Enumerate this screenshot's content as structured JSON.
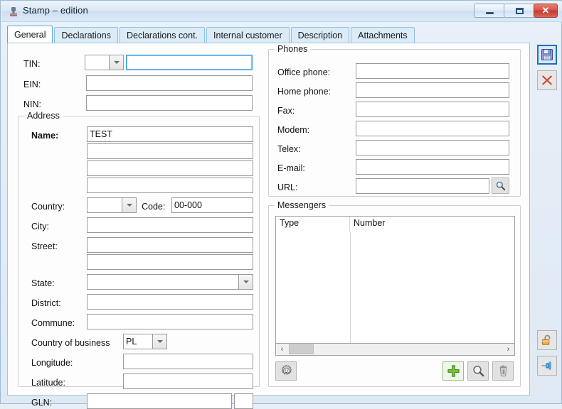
{
  "window": {
    "title": "Stamp – edition",
    "app_icon": "stamp-icon",
    "controls": {
      "minimize": "Minimize",
      "maximize": "Maximize",
      "close": "Close"
    }
  },
  "tabs": [
    {
      "label": "General",
      "active": true
    },
    {
      "label": "Declarations",
      "active": false
    },
    {
      "label": "Declarations cont.",
      "active": false
    },
    {
      "label": "Internal customer",
      "active": false
    },
    {
      "label": "Description",
      "active": false
    },
    {
      "label": "Attachments",
      "active": false
    }
  ],
  "identifiers": {
    "tin": {
      "label": "TIN:",
      "prefix_value": "",
      "value": ""
    },
    "ein": {
      "label": "EIN:",
      "value": ""
    },
    "nin": {
      "label": "NIN:",
      "value": ""
    }
  },
  "address": {
    "legend": "Address",
    "name": {
      "label": "Name:",
      "value": "TEST"
    },
    "name_line2": "",
    "name_line3": "",
    "name_line4": "",
    "country": {
      "label": "Country:",
      "value": ""
    },
    "code": {
      "label": "Code:",
      "value": "00-000"
    },
    "city": {
      "label": "City:",
      "value": ""
    },
    "street": {
      "label": "Street:",
      "value": ""
    },
    "street_line2": "",
    "state": {
      "label": "State:",
      "value": ""
    },
    "district": {
      "label": "District:",
      "value": ""
    },
    "commune": {
      "label": "Commune:",
      "value": ""
    },
    "country_of_business": {
      "label": "Country of business",
      "suffix": ":",
      "value": "PL"
    },
    "longitude": {
      "label": "Longitude:",
      "value": ""
    },
    "latitude": {
      "label": "Latitude:",
      "value": ""
    },
    "gln": {
      "label": "GLN:",
      "value": "",
      "check_value": ""
    }
  },
  "phones": {
    "legend": "Phones",
    "rows": [
      {
        "label": "Office phone:",
        "value": ""
      },
      {
        "label": "Home phone:",
        "value": ""
      },
      {
        "label": "Fax:",
        "value": ""
      },
      {
        "label": "Modem:",
        "value": ""
      },
      {
        "label": "Telex:",
        "value": ""
      },
      {
        "label": "E-mail:",
        "value": ""
      }
    ],
    "url": {
      "label": "URL:",
      "value": "",
      "browse_icon": "magnifier-icon"
    }
  },
  "messengers": {
    "legend": "Messengers",
    "columns": [
      "Type",
      "Number"
    ],
    "rows": [],
    "toolbar": {
      "settings": "settings-gear-icon",
      "add": "add-plus-icon",
      "find": "magnifier-icon",
      "delete": "trash-icon"
    },
    "scrollbar": {
      "left_arrow": "‹",
      "right_arrow": "›"
    }
  },
  "side_toolbar": {
    "save": {
      "icon": "save-floppy-icon",
      "selected": true
    },
    "cancel": {
      "icon": "cancel-x-icon",
      "selected": false
    },
    "unlock": {
      "icon": "open-padlock-icon",
      "selected": false
    },
    "pin": {
      "icon": "pin-icon",
      "selected": false
    }
  },
  "colors": {
    "accent_blue": "#1f6fc4",
    "tab_border": "#8ec2e8",
    "close_red": "#c4392e",
    "add_green": "#5aad2a",
    "lock_orange": "#e8a33a"
  }
}
